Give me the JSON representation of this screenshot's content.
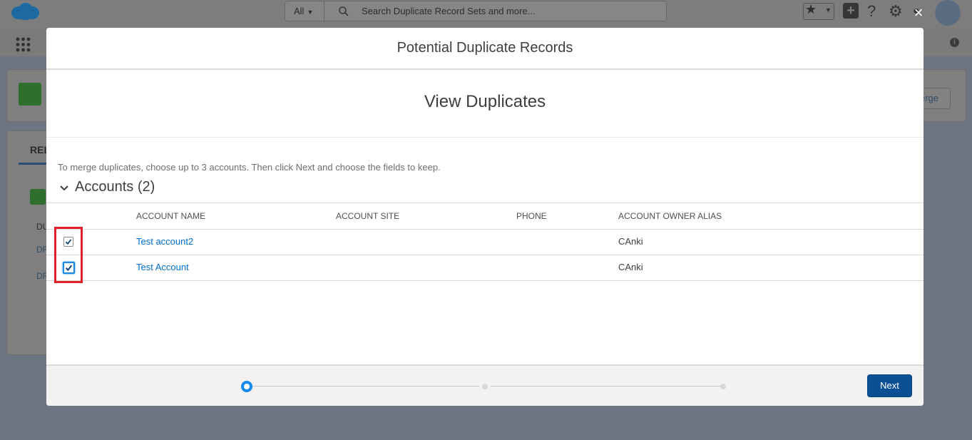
{
  "global_header": {
    "search_scope": "All",
    "search_placeholder": "Search Duplicate Record Sets and more..."
  },
  "background_page": {
    "merge_button_fragment": "erge",
    "tab_fragment": "REL",
    "column_fragment": "DU",
    "row_fragments": [
      "DR",
      "DR"
    ]
  },
  "modal": {
    "title": "Potential Duplicate Records",
    "step_title": "View Duplicates",
    "instructions": "To merge duplicates, choose up to 3 accounts. Then click Next and choose the fields to keep.",
    "section_title": "Accounts (2)",
    "columns": [
      "ACCOUNT NAME",
      "ACCOUNT SITE",
      "PHONE",
      "ACCOUNT OWNER ALIAS"
    ],
    "rows": [
      {
        "checked": true,
        "account_name": "Test account2",
        "account_site": "",
        "phone": "",
        "owner_alias": "CAnki"
      },
      {
        "checked": true,
        "account_name": "Test Account",
        "account_site": "",
        "phone": "",
        "owner_alias": "CAnki"
      }
    ],
    "progress": {
      "total_steps": 3,
      "current_step": 1
    },
    "next_label": "Next",
    "close_label": "×"
  },
  "colors": {
    "brand_blue": "#0b4f94",
    "link_blue": "#006dcc",
    "step_active": "#1589ee",
    "annotation_red": "#e0212a"
  },
  "icons": [
    "salesforce-cloud-logo",
    "search-icon",
    "favorites-star-icon",
    "add-icon",
    "help-icon",
    "setup-gear-icon",
    "notification-bell-icon",
    "avatar",
    "app-launcher-waffle-icon",
    "info-icon",
    "close-icon",
    "chevron-down-icon",
    "checkbox-checked-icon"
  ]
}
